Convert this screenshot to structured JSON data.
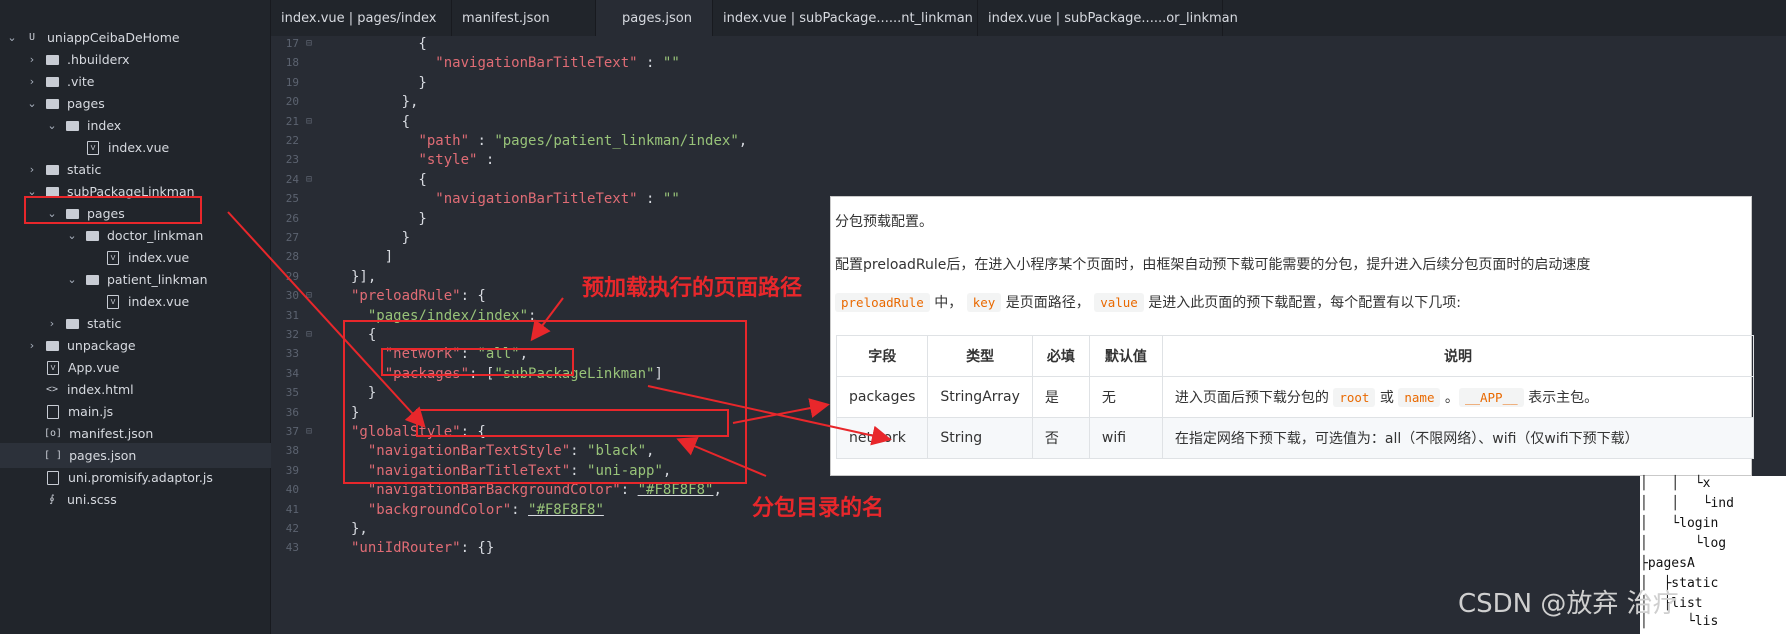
{
  "sidebar": {
    "items": [
      {
        "label": "uniappCeibaDeHome",
        "chev": "⌄",
        "icon": "project",
        "icon_text": "U",
        "indent": 0
      },
      {
        "label": ".hbuilderx",
        "chev": "›",
        "icon": "folder",
        "indent": 1
      },
      {
        "label": ".vite",
        "chev": "›",
        "icon": "folder",
        "indent": 1
      },
      {
        "label": "pages",
        "chev": "⌄",
        "icon": "folder",
        "indent": 1
      },
      {
        "label": "index",
        "chev": "⌄",
        "icon": "folder",
        "indent": 2
      },
      {
        "label": "index.vue",
        "chev": "",
        "icon": "file",
        "icon_text": "V",
        "indent": 3
      },
      {
        "label": "static",
        "chev": "›",
        "icon": "folder",
        "indent": 1
      },
      {
        "label": "subPackageLinkman",
        "chev": "⌄",
        "icon": "folder",
        "indent": 1
      },
      {
        "label": "pages",
        "chev": "⌄",
        "icon": "folder",
        "indent": 2
      },
      {
        "label": "doctor_linkman",
        "chev": "⌄",
        "icon": "folder",
        "indent": 3
      },
      {
        "label": "index.vue",
        "chev": "",
        "icon": "file",
        "icon_text": "V",
        "indent": 4
      },
      {
        "label": "patient_linkman",
        "chev": "⌄",
        "icon": "folder",
        "indent": 3
      },
      {
        "label": "index.vue",
        "chev": "",
        "icon": "file",
        "icon_text": "V",
        "indent": 4
      },
      {
        "label": "static",
        "chev": "›",
        "icon": "folder",
        "indent": 2
      },
      {
        "label": "unpackage",
        "chev": "›",
        "icon": "folder",
        "indent": 1
      },
      {
        "label": "App.vue",
        "chev": "",
        "icon": "file",
        "icon_text": "V",
        "indent": 1
      },
      {
        "label": "index.html",
        "chev": "",
        "icon": "txt",
        "icon_text": "<>",
        "indent": 1
      },
      {
        "label": "main.js",
        "chev": "",
        "icon": "file",
        "icon_text": "",
        "indent": 1
      },
      {
        "label": "manifest.json",
        "chev": "",
        "icon": "txt",
        "icon_text": "[o]",
        "indent": 1
      },
      {
        "label": "pages.json",
        "chev": "",
        "icon": "txt",
        "icon_text": "[ ]",
        "indent": 1,
        "selected": true
      },
      {
        "label": "uni.promisify.adaptor.js",
        "chev": "",
        "icon": "file",
        "icon_text": "",
        "indent": 1
      },
      {
        "label": "uni.scss",
        "chev": "",
        "icon": "txt",
        "icon_text": "∮",
        "indent": 1
      }
    ]
  },
  "tabs": [
    {
      "label": "index.vue | pages/index",
      "active": false
    },
    {
      "label": "manifest.json",
      "active": false
    },
    {
      "label": "pages.json",
      "active": true
    },
    {
      "label": "index.vue | subPackage......nt_linkman",
      "active": false
    },
    {
      "label": "index.vue | subPackage......or_linkman",
      "active": false
    }
  ],
  "editor": {
    "lines": [
      {
        "n": "17",
        "fold": "⊟",
        "html": "<span class='p'>        {</span>"
      },
      {
        "n": "18",
        "fold": "",
        "html": "<span class='p'>          </span><span class='k'>\"navigationBarTitleText\"</span><span class='p'> : </span><span class='s'>\"\"</span>"
      },
      {
        "n": "19",
        "fold": "",
        "html": "<span class='p'>        }</span>"
      },
      {
        "n": "20",
        "fold": "",
        "html": "<span class='p'>      },</span>"
      },
      {
        "n": "21",
        "fold": "⊟",
        "html": "<span class='p'>      {</span>"
      },
      {
        "n": "22",
        "fold": "",
        "html": "<span class='p'>        </span><span class='k'>\"path\"</span><span class='p'> : </span><span class='s'>\"pages/patient_linkman/index\"</span><span class='p'>,</span>"
      },
      {
        "n": "23",
        "fold": "",
        "html": "<span class='p'>        </span><span class='k'>\"style\"</span><span class='p'> :</span>"
      },
      {
        "n": "24",
        "fold": "⊟",
        "html": "<span class='p'>        {</span>"
      },
      {
        "n": "25",
        "fold": "",
        "html": "<span class='p'>          </span><span class='k'>\"navigationBarTitleText\"</span><span class='p'> : </span><span class='s'>\"\"</span>"
      },
      {
        "n": "26",
        "fold": "",
        "html": "<span class='p'>        }</span>"
      },
      {
        "n": "27",
        "fold": "",
        "html": "<span class='p'>      }</span>"
      },
      {
        "n": "28",
        "fold": "",
        "html": "<span class='p'>    ]</span>"
      },
      {
        "n": "29",
        "fold": "",
        "html": "<span class='p'>}],</span>"
      },
      {
        "n": "30",
        "fold": "⊟",
        "html": "<span class='k'>\"preloadRule\"</span><span class='p'>: {</span>"
      },
      {
        "n": "31",
        "fold": "",
        "html": "<span class='p'>  </span><span class='s'>\"pages/index/index\"</span><span class='p'>:</span>"
      },
      {
        "n": "32",
        "fold": "⊟",
        "html": "<span class='p'>  {</span>"
      },
      {
        "n": "33",
        "fold": "",
        "html": "<span class='p'>    </span><span class='k'>\"network\"</span><span class='p'>: </span><span class='s'>\"all\"</span><span class='p'>,</span>"
      },
      {
        "n": "34",
        "fold": "",
        "html": "<span class='p'>    </span><span class='k'>\"packages\"</span><span class='p'>: [</span><span class='s'>\"subPackageLinkman\"</span><span class='p'>]</span>"
      },
      {
        "n": "35",
        "fold": "",
        "html": "<span class='p'>  }</span>"
      },
      {
        "n": "36",
        "fold": "",
        "html": "<span class='p'>}</span>"
      },
      {
        "n": "37",
        "fold": "⊟",
        "html": "<span class='k'>\"globalStyle\"</span><span class='p'>: {</span>"
      },
      {
        "n": "38",
        "fold": "",
        "html": "<span class='p'>  </span><span class='k'>\"navigationBarTextStyle\"</span><span class='p'>: </span><span class='s'>\"black\"</span><span class='p'>,</span>"
      },
      {
        "n": "39",
        "fold": "",
        "html": "<span class='p'>  </span><span class='k'>\"navigationBarTitleText\"</span><span class='p'>: </span><span class='s'>\"uni-app\"</span><span class='p'>,</span>"
      },
      {
        "n": "40",
        "fold": "",
        "html": "<span class='p'>  </span><span class='k'>\"navigationBarBackgroundColor\"</span><span class='p'>: </span><span class='s u'>\"#F8F8F8\"</span><span class='p'>,</span>"
      },
      {
        "n": "41",
        "fold": "",
        "html": "<span class='p'>  </span><span class='k'>\"backgroundColor\"</span><span class='p'>: </span><span class='s u'>\"#F8F8F8\"</span>"
      },
      {
        "n": "42",
        "fold": "",
        "html": "<span class='p'>},</span>"
      },
      {
        "n": "43",
        "fold": "",
        "html": "<span class='k'>\"uniIdRouter\"</span><span class='p'>: {}</span>"
      }
    ]
  },
  "doc": {
    "intro": "分包预载配置。",
    "desc": "配置preloadRule后，在进入小程序某个页面时，由框架自动预下载可能需要的分包，提升进入后续分包页面时的启动速度",
    "line3": {
      "chip1": "preloadRule",
      "t1": " 中，",
      "chip2": "key",
      "t2": " 是页面路径，",
      "chip3": "value",
      "t3": " 是进入此页面的预下载配置，每个配置有以下几项:"
    },
    "table": {
      "headers": [
        "字段",
        "类型",
        "必填",
        "默认值",
        "说明"
      ],
      "rows": [
        {
          "field": "packages",
          "type": "StringArray",
          "required": "是",
          "default": "无",
          "desc_a": "进入页面后预下载分包的 ",
          "chip_a": "root",
          "desc_b": " 或 ",
          "chip_b": "name",
          "desc_c": " 。",
          "chip_c": "__APP__",
          "desc_d": " 表示主包。"
        },
        {
          "field": "network",
          "type": "String",
          "required": "否",
          "default": "wifi",
          "desc_a": "在指定网络下预下载，可选值为：all（不限网络）、wifi（仅wifi下预下载）"
        }
      ]
    }
  },
  "fragments": {
    "lines": [
      "│   │  └x",
      "│   │   └ind",
      "│   └login",
      "│      └log",
      "├pagesA",
      "│  ├static",
      "│  ├list",
      "│     └lis"
    ]
  },
  "annotations": {
    "path_label": "预加载执行的页面路径",
    "subpkg_label": "分包目录的名"
  },
  "watermark": "CSDN @放弃    治疗",
  "colors": {
    "annotation": "#e8272b",
    "key": "#e06c75",
    "string": "#98c379",
    "chip": "#e96900"
  }
}
